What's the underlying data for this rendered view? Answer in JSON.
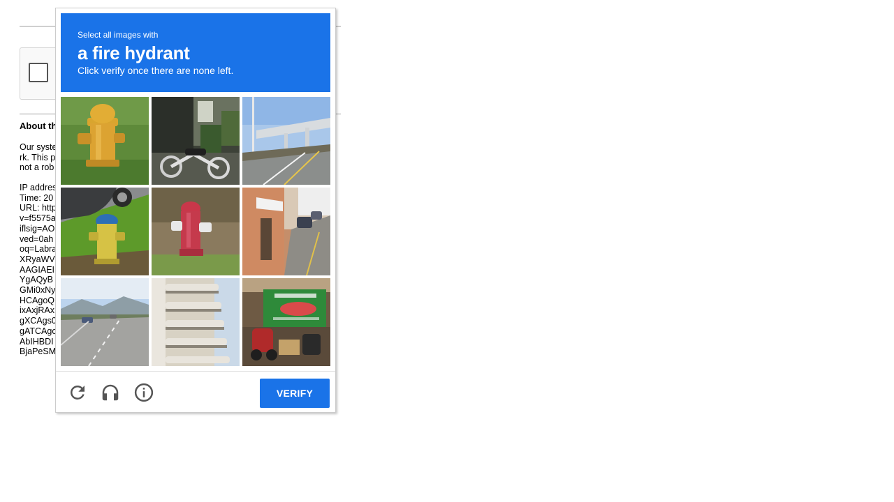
{
  "background": {
    "about_title": "About th",
    "about_lines": [
      "Our syste",
      "rk. This p",
      "not a rob"
    ],
    "detail_lines": [
      "IP addres",
      "Time: 20",
      "URL: http",
      "v=f5575a",
      "iflsig=AO",
      "ved=0ah",
      "oq=Labra",
      "XRyaWV",
      "AAGIAEI",
      "YgAQyB",
      "GMi0xNy",
      "HCAgoQ",
      "ixAxjRAx",
      "gXCAgs0",
      "gATCAgo",
      "AbIHBDI",
      "BjaPeSM"
    ]
  },
  "challenge": {
    "header": {
      "pre_text": "Select all images with",
      "target": "a fire hydrant",
      "post_text": "Click verify once there are none left."
    },
    "tiles": [
      {
        "id": 1,
        "content": "yellow fire hydrant on grass"
      },
      {
        "id": 2,
        "content": "motorcycle parked in front of shop"
      },
      {
        "id": 3,
        "content": "highway overpass and road"
      },
      {
        "id": 4,
        "content": "blue and yellow fire hydrant"
      },
      {
        "id": 5,
        "content": "red fire hydrant"
      },
      {
        "id": 6,
        "content": "street with buildings and parked cars"
      },
      {
        "id": 7,
        "content": "highway with cars and mountains"
      },
      {
        "id": 8,
        "content": "apartment building balconies"
      },
      {
        "id": 9,
        "content": "storefront with green sign and scooters"
      }
    ],
    "footer": {
      "reload_icon": "reload-icon",
      "audio_icon": "headphones-icon",
      "info_icon": "info-icon",
      "verify_label": "VERIFY"
    }
  },
  "colors": {
    "accent": "#1a73e8",
    "icon_gray": "#555555"
  }
}
